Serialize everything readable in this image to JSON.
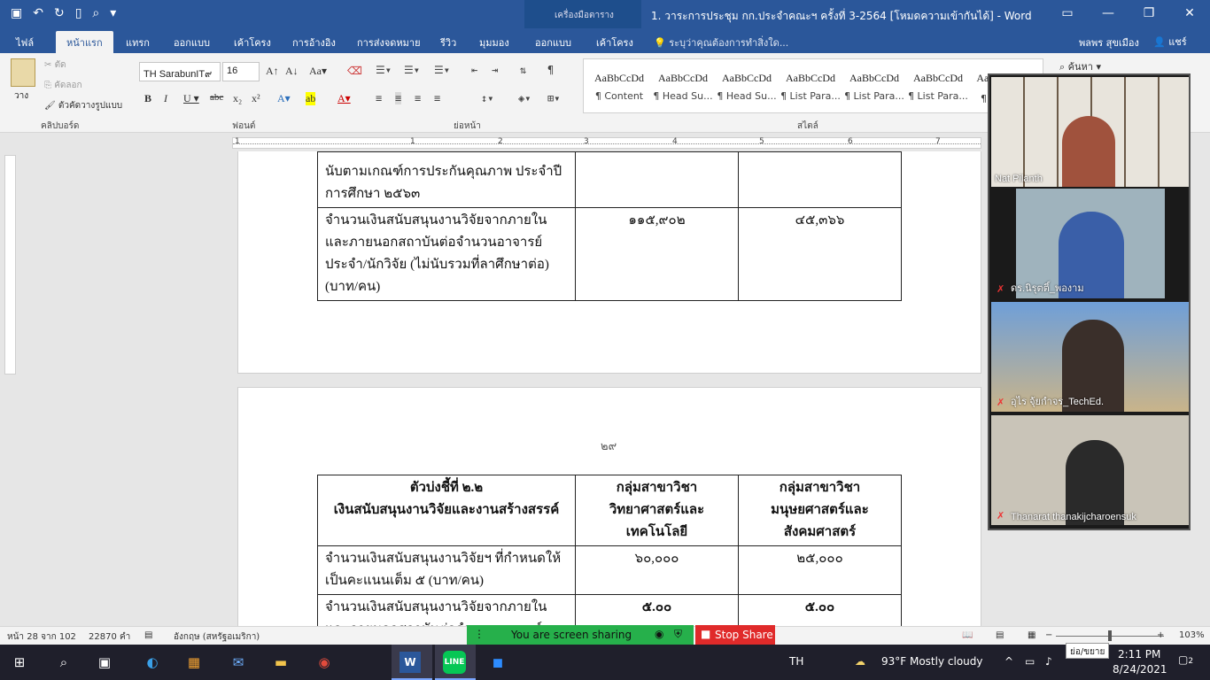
{
  "titlebar": {
    "context_tab": "เครื่องมือตาราง",
    "doc_title": "1. วาระการประชุม กก.ประจำคณะฯ ครั้งที่ 3-2564 [โหมดความเข้ากันได้] - Word (การเปิดใช้งาน..."
  },
  "tabs": {
    "file": "ไฟล์",
    "home": "หน้าแรก",
    "insert": "แทรก",
    "design": "ออกแบบ",
    "layout": "เค้าโครง",
    "references": "การอ้างอิง",
    "mailings": "การส่งจดหมาย",
    "review": "รีวิว",
    "view": "มุมมอง",
    "table_design": "ออกแบบ",
    "table_layout": "เค้าโครง",
    "tell_me": "ระบุว่าคุณต้องการทำสิ่งใด...",
    "user": "พลพร สุขเมือง",
    "share": "แชร์"
  },
  "ribbon": {
    "clipboard": {
      "paste": "วาง",
      "cut": "ตัด",
      "copy": "คัดลอก",
      "format_painter": "ตัวคัดวางรูปแบบ",
      "label": "คลิปบอร์ด"
    },
    "font": {
      "name": "TH SarabunIT๙",
      "size": "16",
      "label": "ฟอนต์"
    },
    "paragraph": {
      "label": "ย่อหน้า"
    },
    "styles": {
      "label": "สไตล์",
      "items": [
        {
          "sample": "AaBbCcDd",
          "name": "¶ Content"
        },
        {
          "sample": "AaBbCcDd",
          "name": "¶ Head Su..."
        },
        {
          "sample": "AaBbCcDd",
          "name": "¶ Head Su..."
        },
        {
          "sample": "AaBbCcDd",
          "name": "¶ List Para..."
        },
        {
          "sample": "AaBbCcDd",
          "name": "¶ List Para..."
        },
        {
          "sample": "AaBbCcDd",
          "name": "¶ List Para..."
        },
        {
          "sample": "AaBl",
          "name": "¶ ไ"
        }
      ]
    },
    "find": "ค้นหา"
  },
  "ruler": {
    "numbers": [
      "1",
      "1",
      "2",
      "3",
      "4",
      "5",
      "6",
      "7"
    ]
  },
  "page1": {
    "rows": [
      {
        "c1": "นับตามเกณฑ์การประกันคุณภาพ ประจำปีการศึกษา ๒๕๖๓",
        "c2": "",
        "c3": ""
      },
      {
        "c1": "จำนวนเงินสนับสนุนงานวิจัยจากภายในและภายนอกสถาบันต่อจำนวนอาจารย์ประจำ/นักวิจัย (ไม่นับรวมที่ลาศึกษาต่อ) (บาท/คน)",
        "c2": "๑๑๕,๙๐๒",
        "c3": "๔๕,๓๖๖"
      }
    ]
  },
  "page2": {
    "page_number": "๒๙",
    "header": {
      "c1_line1": "ตัวบ่งชี้ที่ ๒.๒",
      "c1_line2": "เงินสนับสนุนงานวิจัยและงานสร้างสรรค์",
      "c2": "กลุ่มสาขาวิชาวิทยาศาสตร์และเทคโนโลยี",
      "c3": "กลุ่มสาขาวิชามนุษยศาสตร์และสังคมศาสตร์"
    },
    "rows": [
      {
        "c1": "จำนวนเงินสนับสนุนงานวิจัยฯ ที่กำหนดให้เป็นคะแนนเต็ม ๕ (บาท/คน)",
        "c2": "๖๐,๐๐๐",
        "c3": "๒๕,๐๐๐"
      },
      {
        "c1": "จำนวนเงินสนับสนุนงานวิจัยจากภายในและภายนอกสถาบันต่อจำนวนอาจารย์ประจำ/นักวิจัย (ไม่นับรวมที่ลาศึกษาต่อ)",
        "c2": "๕.๐๐",
        "c3": "๕.๐๐"
      }
    ]
  },
  "status": {
    "page": "หน้า 28 จาก 102",
    "words": "22870 คำ",
    "language": "อังกฤษ (สหรัฐอเมริกา)",
    "zoom": "103%",
    "zoom_level": 1.03
  },
  "screenshare": {
    "sharing": "You are screen sharing",
    "stop": "Stop Share"
  },
  "zoom_participants": [
    {
      "name": "Nat Pilanth",
      "muted": false,
      "bg": "#b8a890"
    },
    {
      "name": "ดร.นิรุตติ์_พองาม",
      "muted": true,
      "bg": "#8fa3ad"
    },
    {
      "name": "อุไร จุ้ยกำจร_TechEd.",
      "muted": true,
      "bg": "#7d94b0"
    },
    {
      "name": "Thanarat thanakijcharoensuk",
      "muted": true,
      "bg": "#c9c4b8"
    }
  ],
  "taskbar": {
    "lang": "TH",
    "weather": "93°F  Mostly cloudy",
    "time": "2:11 PM",
    "date": "8/24/2021",
    "notifications": "2",
    "tooltip": "ย่อ/ขยาย"
  },
  "colors": {
    "word_blue": "#2b579a",
    "share_green": "#26b04b",
    "stop_red": "#e02a2a"
  }
}
